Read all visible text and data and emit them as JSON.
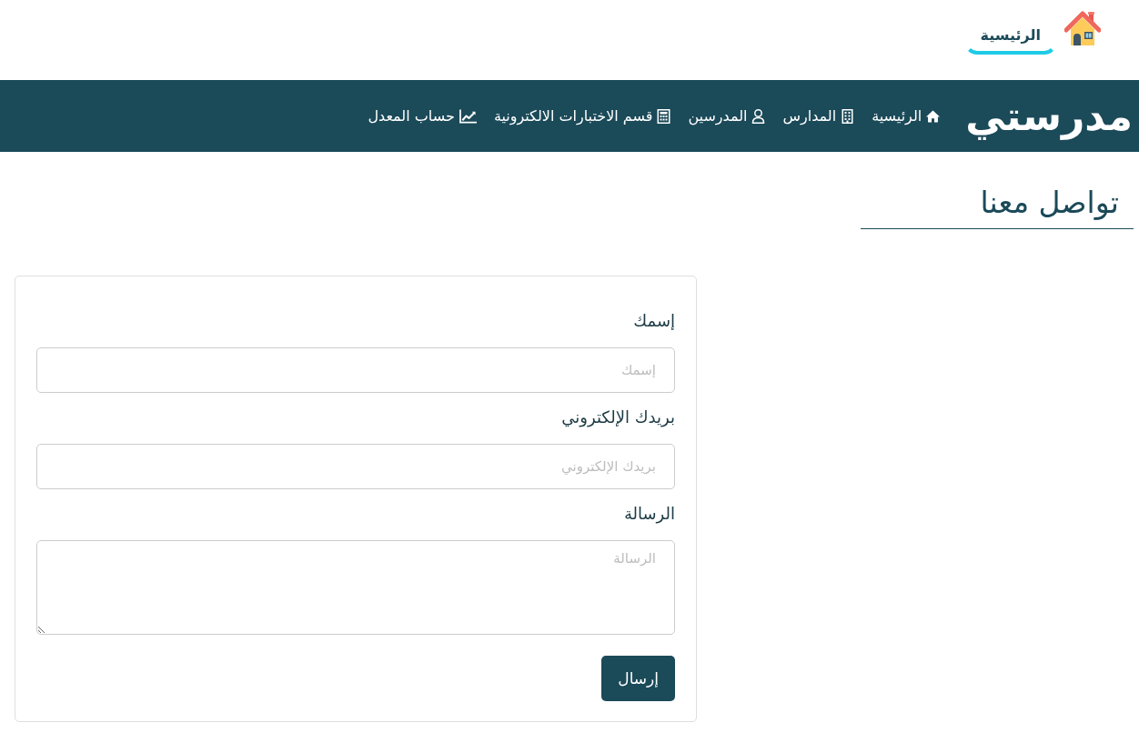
{
  "top_tabs": [
    {
      "label": "الرئيسية",
      "selected": true
    }
  ],
  "navbar": {
    "logo": "مدرستي",
    "items": [
      {
        "kind": "home",
        "label": "الرئيسية"
      },
      {
        "kind": "building",
        "label": "المدارس"
      },
      {
        "kind": "user",
        "label": "المدرسين"
      },
      {
        "kind": "calculator",
        "label": "قسم الاختبارات الالكترونية"
      },
      {
        "kind": "chart",
        "label": "حساب المعدل"
      }
    ]
  },
  "page_title": "تواصل معنا",
  "contact_form": {
    "fields": [
      {
        "kind": "input",
        "label": "إسمك",
        "placeholder": "إسمك"
      },
      {
        "kind": "input",
        "label": "بريدك الإلكتروني",
        "placeholder": "بريدك الإلكتروني"
      },
      {
        "kind": "textarea",
        "label": "الرسالة",
        "placeholder": "الرسالة"
      }
    ],
    "submit_button": "إرسال"
  }
}
